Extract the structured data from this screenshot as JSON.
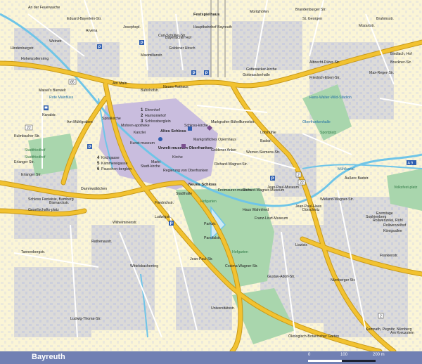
{
  "map_title": "Bayreuth",
  "scale": {
    "labels": [
      "0",
      "100",
      "200 m"
    ]
  },
  "colors": {
    "land": "#fbf5d6",
    "major_road": "#f2c230",
    "old_town": "#c9bdde",
    "park": "#a9d6ad",
    "water": "#6fc5e8",
    "built": "#c2c6da",
    "footer": "#7180b3"
  },
  "road_labels": [
    "An der Feuerwache",
    "Eduard-Bayerlein-Str.",
    "Arvena",
    "Weinstr.",
    "Josephspl.",
    "Am Main",
    "Carl-Schüller-Str.",
    "Nürnberger Str.",
    "Friedrichstr.",
    "Ludwigstr.",
    "Wilhelminenstr.",
    "Rathenaustr.",
    "Tannenbergstr.",
    "Lisztstr.",
    "Richard-Wagner-Str.",
    "Werner-Siemens-Str.",
    "Albrecht-Dürer-Str.",
    "Bahnhofstr.",
    "Kanalstr.",
    "Kulmbacher Str.",
    "Erlanger Str.",
    "Dammwäldchen",
    "Bismarckstr.",
    "Ludwig-Thoma-Str.",
    "Parsifalstr.",
    "Gustav-Adolf-Str.",
    "Dürschnitz",
    "Universitätsstr.",
    "Königsallee",
    "Äußere Badstr.",
    "Wieland-Wagner-Str.",
    "Hohenzollernring",
    "Cosima-Wagner-Str.",
    "Jean-Paul-Str.",
    "Frankenstr.",
    "Tunnelstr.",
    "Badstr.",
    "Wittelsbacherring",
    "Maximilianstr.",
    "Brandenburger Str.",
    "Hindenburgstr.",
    "Moritzhöfen",
    "St. Georgen",
    "Mozartstr.",
    "Brahmsstr.",
    "Bindlach, Hof",
    "Bruckner-Str.",
    "Max-Reger-Str.",
    "Gottesacker-kirche",
    "Friedrich-Ebert-Str.",
    "Hans-Walter-Wild-Stadion",
    "Oberfrankenhalle",
    "Mühlkanal",
    "Kemnath, Pegnitz, Nürnberg",
    "Am Kreuzstein",
    "Ökologisch-Botanischer Garten",
    "Rote Mainfluss",
    "Festspielhaus",
    "Hauptbahnhof Bayreuth",
    "Bayerischer Hof",
    "Goldener Hirsch",
    "Stadtfriedhof",
    "Gottesackerhalle",
    "Erlanger Str.",
    "Am Mühlgraben",
    "Parkstr.",
    "Sophienberg",
    "Markgrafen-Bühne"
  ],
  "sights": [
    {
      "num": "1",
      "label": "Ehrenhof"
    },
    {
      "num": "2",
      "label": "Harmoniehof"
    },
    {
      "num": "3",
      "label": "Schlossberglein"
    },
    {
      "num": "4",
      "label": "Kirchgasse"
    },
    {
      "num": "5",
      "label": "Kämmereigasse"
    },
    {
      "num": "6",
      "label": "Pauschen-berglein"
    }
  ],
  "place_labels": [
    "Mohren-apotheke",
    "Altes Schloss",
    "Schloss-kirche",
    "Markgräfliches Opernhaus",
    "Goldener Anker",
    "Urwelt-museum Oberfranken",
    "Kunst-museum",
    "Neues Rathaus",
    "Stadt-kirche",
    "Spitalkirche",
    "Regierung von Oberfranken",
    "Neues Schloss",
    "Stadthalle",
    "Hofgarten",
    "Freimaurer-museum",
    "Richard-Wagner-Museum",
    "Jean-Paul-Museum",
    "Haus Wahnfried",
    "Franz-Liszt-Museum",
    "Jean-Paul-Haus",
    "Maisel's Bierwelt",
    "Rollwenzelei, Röhl",
    "Eremitage",
    "Volksfest-platz",
    "Sportplatz",
    "Markt",
    "Gesellschafts-platz",
    "Schloss Fantaisie, Bamberg",
    "Kirche",
    "Rollwenzelhof",
    "Kanzlei",
    "Stadtfriedhof",
    "Hofgarten",
    "Lohmühle"
  ],
  "route_shields": [
    "85",
    "2",
    "22",
    "2",
    "22",
    "A 9"
  ],
  "icons": [
    "parking-icon",
    "bus-icon",
    "church-icon",
    "hotel-icon",
    "info-icon",
    "museum-icon"
  ]
}
